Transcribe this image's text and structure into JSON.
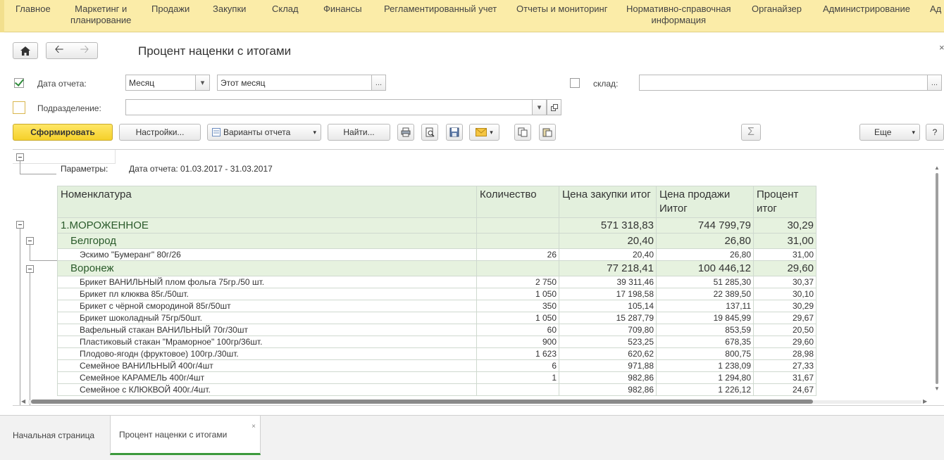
{
  "menu": {
    "items": [
      {
        "label": "Главное"
      },
      {
        "label": "Маркетинг и\nпланирование"
      },
      {
        "label": "Продажи"
      },
      {
        "label": "Закупки"
      },
      {
        "label": "Склад"
      },
      {
        "label": "Финансы"
      },
      {
        "label": "Регламентированный учет"
      },
      {
        "label": "Отчеты и мониторинг"
      },
      {
        "label": "Нормативно-справочная\nинформация"
      },
      {
        "label": "Органайзер"
      },
      {
        "label": "Администрирование"
      },
      {
        "label": "Ад"
      }
    ]
  },
  "window": {
    "title": "Процент наценки с итогами",
    "close": "×"
  },
  "filters": {
    "report_date_label": "Дата отчета:",
    "period_type": "Месяц",
    "period_value": "Этот месяц",
    "warehouse_label": "склад:",
    "warehouse_value": "",
    "division_label": "Подразделение:",
    "division_value": "",
    "ellipsis": "...",
    "dropdown": "▾"
  },
  "toolbar": {
    "generate": "Сформировать",
    "settings": "Настройки...",
    "variants": "Варианты отчета",
    "find": "Найти...",
    "sum": "Σ",
    "more": "Еще",
    "help": "?"
  },
  "report": {
    "params_label": "Параметры:",
    "params_value": "Дата отчета: 01.03.2017 - 31.03.2017",
    "headers": {
      "name": "Номенклатура",
      "qty": "Количество",
      "buy": "Цена закупки итог",
      "sell": "Цена продажи Иитог",
      "pct": "Процент итог"
    },
    "rows": [
      {
        "level": 1,
        "group": true,
        "name": "1.МОРОЖЕННОЕ",
        "qty": "",
        "buy": "571 318,83",
        "sell": "744 799,79",
        "pct": "30,29"
      },
      {
        "level": 2,
        "group": true,
        "name": "Белгород",
        "qty": "",
        "buy": "20,40",
        "sell": "26,80",
        "pct": "31,00"
      },
      {
        "level": 3,
        "group": false,
        "name": "Эскимо \"Бумеранг\" 80г/26",
        "qty": "26",
        "buy": "20,40",
        "sell": "26,80",
        "pct": "31,00"
      },
      {
        "level": 2,
        "group": true,
        "name": "Воронеж",
        "qty": "",
        "buy": "77 218,41",
        "sell": "100 446,12",
        "pct": "29,60"
      },
      {
        "level": 3,
        "group": false,
        "name": "Брикет ВАНИЛЬНЫЙ плом фольга 75гр./50 шт.",
        "qty": "2 750",
        "buy": "39 311,46",
        "sell": "51 285,30",
        "pct": "30,37"
      },
      {
        "level": 3,
        "group": false,
        "name": "Брикет пл клюква 85г./50шт.",
        "qty": "1 050",
        "buy": "17 198,58",
        "sell": "22 389,50",
        "pct": "30,10"
      },
      {
        "level": 3,
        "group": false,
        "name": "Брикет с чёрной смородиной 85г/50шт",
        "qty": "350",
        "buy": "105,14",
        "sell": "137,11",
        "pct": "30,29"
      },
      {
        "level": 3,
        "group": false,
        "name": "Брикет шоколадный 75гр/50шт.",
        "qty": "1 050",
        "buy": "15 287,79",
        "sell": "19 845,99",
        "pct": "29,67"
      },
      {
        "level": 3,
        "group": false,
        "name": "Вафельный стакан ВАНИЛЬНЫЙ 70г/30шт",
        "qty": "60",
        "buy": "709,80",
        "sell": "853,59",
        "pct": "20,50"
      },
      {
        "level": 3,
        "group": false,
        "name": "Пластиковый стакан \"Мраморное\" 100гр/36шт.",
        "qty": "900",
        "buy": "523,25",
        "sell": "678,35",
        "pct": "29,60"
      },
      {
        "level": 3,
        "group": false,
        "name": "Плодово-ягодн (фруктовое) 100гр./30шт.",
        "qty": "1 623",
        "buy": "620,62",
        "sell": "800,75",
        "pct": "28,98"
      },
      {
        "level": 3,
        "group": false,
        "name": "Семейное ВАНИЛЬНЫЙ 400г/4шт",
        "qty": "6",
        "buy": "971,88",
        "sell": "1 238,09",
        "pct": "27,33"
      },
      {
        "level": 3,
        "group": false,
        "name": "Семейное КАРАМЕЛЬ 400г/4шт",
        "qty": "1",
        "buy": "982,86",
        "sell": "1 294,80",
        "pct": "31,67"
      },
      {
        "level": 3,
        "group": false,
        "name": "Семейное с КЛЮКВОЙ 400г./4шт.",
        "qty": "",
        "buy": "982,86",
        "sell": "1 226,12",
        "pct": "24,67"
      }
    ]
  },
  "tabs": {
    "home": "Начальная страница",
    "report": "Процент наценки с итогами",
    "close": "×"
  },
  "colors": {
    "menu_bg": "#fbeca8",
    "primary_button": "#f5d12a",
    "group_row_bg": "#e6f2df",
    "header_bg": "#e3f0dd",
    "active_tab_accent": "#3c9a3c"
  }
}
